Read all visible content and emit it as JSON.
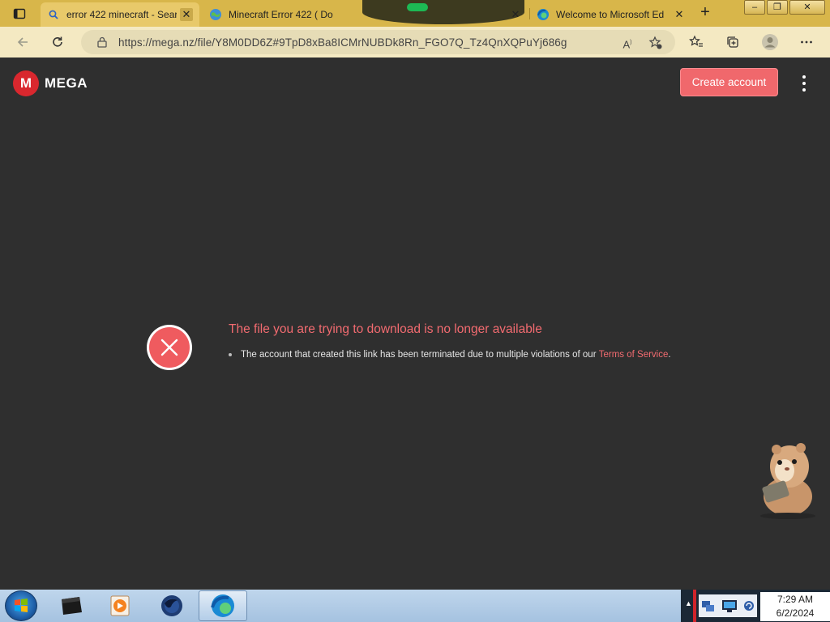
{
  "browser": {
    "tabs": [
      {
        "title": "error 422 minecraft - Sear",
        "icon": "search-icon",
        "active": true
      },
      {
        "title": "Minecraft Error 422 ( Do",
        "icon": "globe-icon",
        "active": false
      },
      {
        "title": "",
        "icon": "",
        "active": false
      },
      {
        "title": "Welcome to Microsoft Ed",
        "icon": "edge-icon",
        "active": false
      }
    ],
    "new_tab": "+",
    "close_glyph": "✕",
    "url": "https://mega.nz/file/Y8M0DD6Z#9TpD8xBa8ICMrNUBDk8Rn_FGO7Q_Tz4QnXQPuYj686g",
    "window_controls": {
      "minimize": "–",
      "restore": "❐",
      "close": "✕"
    },
    "accent": "#d8b64a"
  },
  "mega": {
    "logo_letter": "M",
    "logo_text": "MEGA",
    "create_account": "Create account",
    "error_title": "The file you are trying to download is no longer available",
    "error_detail": "The account that created this link has been terminated due to multiple violations of our",
    "tos_link": "Terms of Service",
    "tos_suffix": ".",
    "accent": "#f0686c"
  },
  "taskbar": {
    "time": "7:29 AM",
    "date": "6/2/2024"
  }
}
